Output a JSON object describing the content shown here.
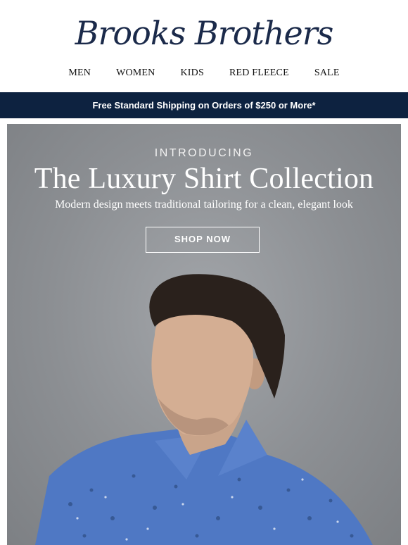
{
  "brand": {
    "logo_text": "Brooks Brothers"
  },
  "nav": {
    "items": [
      "MEN",
      "WOMEN",
      "KIDS",
      "RED FLEECE",
      "SALE"
    ]
  },
  "promo_bar": {
    "text": "Free Standard Shipping on Orders of $250 or More*"
  },
  "hero": {
    "eyebrow": "INTRODUCING",
    "headline": "The Luxury Shirt Collection",
    "subhead": "Modern design meets traditional tailoring for a clean, elegant look",
    "cta_label": "SHOP NOW"
  },
  "colors": {
    "navy": "#0d2240",
    "hero_bg": "#8f9296",
    "shirt_blue": "#4f78c4"
  }
}
